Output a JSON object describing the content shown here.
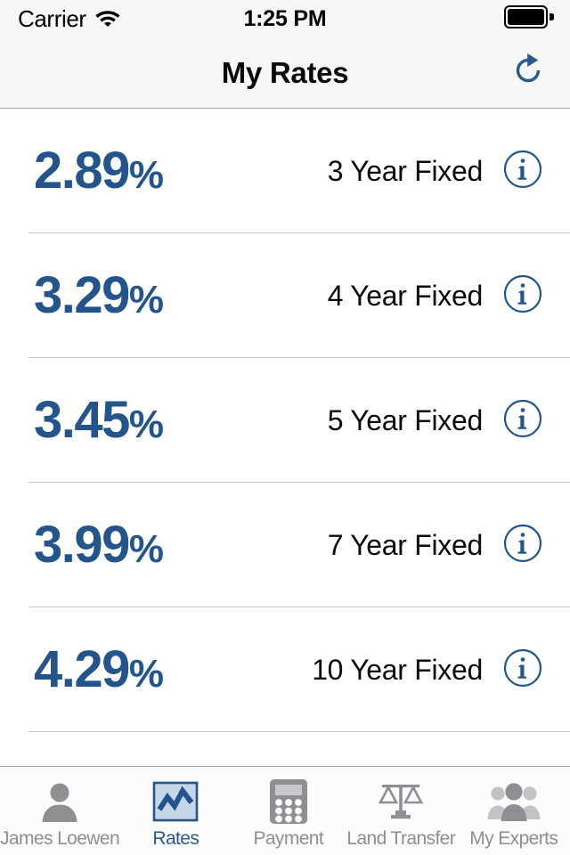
{
  "status_bar": {
    "carrier": "Carrier",
    "wifi_icon": "wifi-icon",
    "time": "1:25 PM",
    "battery_icon": "battery-full-icon"
  },
  "nav_bar": {
    "title": "My Rates",
    "refresh_icon": "refresh-icon"
  },
  "rates": [
    {
      "value": "2.89",
      "percent": "%",
      "term": "3 Year Fixed",
      "info_icon": "info-icon"
    },
    {
      "value": "3.29",
      "percent": "%",
      "term": "4 Year Fixed",
      "info_icon": "info-icon"
    },
    {
      "value": "3.45",
      "percent": "%",
      "term": "5 Year Fixed",
      "info_icon": "info-icon"
    },
    {
      "value": "3.99",
      "percent": "%",
      "term": "7 Year Fixed",
      "info_icon": "info-icon"
    },
    {
      "value": "4.29",
      "percent": "%",
      "term": "10 Year Fixed",
      "info_icon": "info-icon"
    }
  ],
  "tab_bar": {
    "selected": "Rates",
    "items": [
      {
        "label": "James Loewen",
        "icon": "person-icon",
        "active": false
      },
      {
        "label": "Rates",
        "icon": "chart-icon",
        "active": true
      },
      {
        "label": "Payment",
        "icon": "calculator-icon",
        "active": false
      },
      {
        "label": "Land Transfer",
        "icon": "scales-icon",
        "active": false
      },
      {
        "label": "My Experts",
        "icon": "people-icon",
        "active": false
      }
    ]
  },
  "colors": {
    "accent_blue": "#23558C",
    "tab_active": "#2A5A8C",
    "tab_inactive": "#8E8E93",
    "separator": "#C8C7CC",
    "bar_background": "#F7F7F7"
  }
}
